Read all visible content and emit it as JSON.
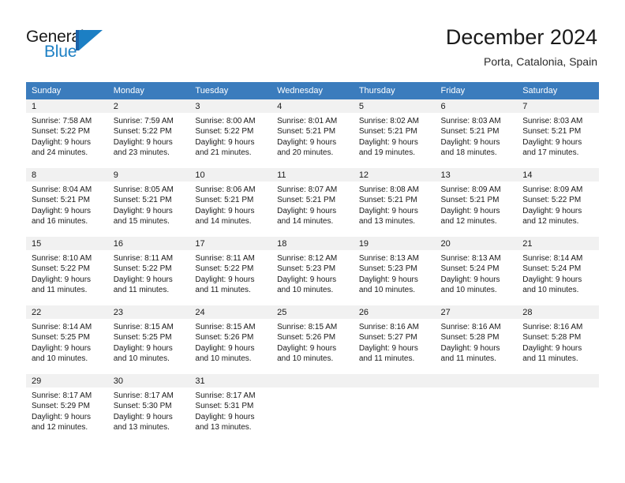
{
  "brand": {
    "name_part1": "General",
    "name_part2": "Blue",
    "mark": "triangle-flag-logo"
  },
  "header": {
    "title": "December 2024",
    "subtitle": "Porta, Catalonia, Spain"
  },
  "calendar": {
    "weekday_headers": [
      "Sunday",
      "Monday",
      "Tuesday",
      "Wednesday",
      "Thursday",
      "Friday",
      "Saturday"
    ],
    "colors": {
      "header_blue": "#3b7cbd",
      "row_divider_blue": "#2e6da4",
      "daynum_band_gray": "#f1f1f1",
      "brand_blue": "#1c7fc4"
    },
    "weeks": [
      {
        "days": [
          {
            "num": "1",
            "sunrise": "Sunrise: 7:58 AM",
            "sunset": "Sunset: 5:22 PM",
            "daylight1": "Daylight: 9 hours",
            "daylight2": "and 24 minutes."
          },
          {
            "num": "2",
            "sunrise": "Sunrise: 7:59 AM",
            "sunset": "Sunset: 5:22 PM",
            "daylight1": "Daylight: 9 hours",
            "daylight2": "and 23 minutes."
          },
          {
            "num": "3",
            "sunrise": "Sunrise: 8:00 AM",
            "sunset": "Sunset: 5:22 PM",
            "daylight1": "Daylight: 9 hours",
            "daylight2": "and 21 minutes."
          },
          {
            "num": "4",
            "sunrise": "Sunrise: 8:01 AM",
            "sunset": "Sunset: 5:21 PM",
            "daylight1": "Daylight: 9 hours",
            "daylight2": "and 20 minutes."
          },
          {
            "num": "5",
            "sunrise": "Sunrise: 8:02 AM",
            "sunset": "Sunset: 5:21 PM",
            "daylight1": "Daylight: 9 hours",
            "daylight2": "and 19 minutes."
          },
          {
            "num": "6",
            "sunrise": "Sunrise: 8:03 AM",
            "sunset": "Sunset: 5:21 PM",
            "daylight1": "Daylight: 9 hours",
            "daylight2": "and 18 minutes."
          },
          {
            "num": "7",
            "sunrise": "Sunrise: 8:03 AM",
            "sunset": "Sunset: 5:21 PM",
            "daylight1": "Daylight: 9 hours",
            "daylight2": "and 17 minutes."
          }
        ]
      },
      {
        "days": [
          {
            "num": "8",
            "sunrise": "Sunrise: 8:04 AM",
            "sunset": "Sunset: 5:21 PM",
            "daylight1": "Daylight: 9 hours",
            "daylight2": "and 16 minutes."
          },
          {
            "num": "9",
            "sunrise": "Sunrise: 8:05 AM",
            "sunset": "Sunset: 5:21 PM",
            "daylight1": "Daylight: 9 hours",
            "daylight2": "and 15 minutes."
          },
          {
            "num": "10",
            "sunrise": "Sunrise: 8:06 AM",
            "sunset": "Sunset: 5:21 PM",
            "daylight1": "Daylight: 9 hours",
            "daylight2": "and 14 minutes."
          },
          {
            "num": "11",
            "sunrise": "Sunrise: 8:07 AM",
            "sunset": "Sunset: 5:21 PM",
            "daylight1": "Daylight: 9 hours",
            "daylight2": "and 14 minutes."
          },
          {
            "num": "12",
            "sunrise": "Sunrise: 8:08 AM",
            "sunset": "Sunset: 5:21 PM",
            "daylight1": "Daylight: 9 hours",
            "daylight2": "and 13 minutes."
          },
          {
            "num": "13",
            "sunrise": "Sunrise: 8:09 AM",
            "sunset": "Sunset: 5:21 PM",
            "daylight1": "Daylight: 9 hours",
            "daylight2": "and 12 minutes."
          },
          {
            "num": "14",
            "sunrise": "Sunrise: 8:09 AM",
            "sunset": "Sunset: 5:22 PM",
            "daylight1": "Daylight: 9 hours",
            "daylight2": "and 12 minutes."
          }
        ]
      },
      {
        "days": [
          {
            "num": "15",
            "sunrise": "Sunrise: 8:10 AM",
            "sunset": "Sunset: 5:22 PM",
            "daylight1": "Daylight: 9 hours",
            "daylight2": "and 11 minutes."
          },
          {
            "num": "16",
            "sunrise": "Sunrise: 8:11 AM",
            "sunset": "Sunset: 5:22 PM",
            "daylight1": "Daylight: 9 hours",
            "daylight2": "and 11 minutes."
          },
          {
            "num": "17",
            "sunrise": "Sunrise: 8:11 AM",
            "sunset": "Sunset: 5:22 PM",
            "daylight1": "Daylight: 9 hours",
            "daylight2": "and 11 minutes."
          },
          {
            "num": "18",
            "sunrise": "Sunrise: 8:12 AM",
            "sunset": "Sunset: 5:23 PM",
            "daylight1": "Daylight: 9 hours",
            "daylight2": "and 10 minutes."
          },
          {
            "num": "19",
            "sunrise": "Sunrise: 8:13 AM",
            "sunset": "Sunset: 5:23 PM",
            "daylight1": "Daylight: 9 hours",
            "daylight2": "and 10 minutes."
          },
          {
            "num": "20",
            "sunrise": "Sunrise: 8:13 AM",
            "sunset": "Sunset: 5:24 PM",
            "daylight1": "Daylight: 9 hours",
            "daylight2": "and 10 minutes."
          },
          {
            "num": "21",
            "sunrise": "Sunrise: 8:14 AM",
            "sunset": "Sunset: 5:24 PM",
            "daylight1": "Daylight: 9 hours",
            "daylight2": "and 10 minutes."
          }
        ]
      },
      {
        "days": [
          {
            "num": "22",
            "sunrise": "Sunrise: 8:14 AM",
            "sunset": "Sunset: 5:25 PM",
            "daylight1": "Daylight: 9 hours",
            "daylight2": "and 10 minutes."
          },
          {
            "num": "23",
            "sunrise": "Sunrise: 8:15 AM",
            "sunset": "Sunset: 5:25 PM",
            "daylight1": "Daylight: 9 hours",
            "daylight2": "and 10 minutes."
          },
          {
            "num": "24",
            "sunrise": "Sunrise: 8:15 AM",
            "sunset": "Sunset: 5:26 PM",
            "daylight1": "Daylight: 9 hours",
            "daylight2": "and 10 minutes."
          },
          {
            "num": "25",
            "sunrise": "Sunrise: 8:15 AM",
            "sunset": "Sunset: 5:26 PM",
            "daylight1": "Daylight: 9 hours",
            "daylight2": "and 10 minutes."
          },
          {
            "num": "26",
            "sunrise": "Sunrise: 8:16 AM",
            "sunset": "Sunset: 5:27 PM",
            "daylight1": "Daylight: 9 hours",
            "daylight2": "and 11 minutes."
          },
          {
            "num": "27",
            "sunrise": "Sunrise: 8:16 AM",
            "sunset": "Sunset: 5:28 PM",
            "daylight1": "Daylight: 9 hours",
            "daylight2": "and 11 minutes."
          },
          {
            "num": "28",
            "sunrise": "Sunrise: 8:16 AM",
            "sunset": "Sunset: 5:28 PM",
            "daylight1": "Daylight: 9 hours",
            "daylight2": "and 11 minutes."
          }
        ]
      },
      {
        "days": [
          {
            "num": "29",
            "sunrise": "Sunrise: 8:17 AM",
            "sunset": "Sunset: 5:29 PM",
            "daylight1": "Daylight: 9 hours",
            "daylight2": "and 12 minutes."
          },
          {
            "num": "30",
            "sunrise": "Sunrise: 8:17 AM",
            "sunset": "Sunset: 5:30 PM",
            "daylight1": "Daylight: 9 hours",
            "daylight2": "and 13 minutes."
          },
          {
            "num": "31",
            "sunrise": "Sunrise: 8:17 AM",
            "sunset": "Sunset: 5:31 PM",
            "daylight1": "Daylight: 9 hours",
            "daylight2": "and 13 minutes."
          },
          {
            "num": "",
            "sunrise": "",
            "sunset": "",
            "daylight1": "",
            "daylight2": ""
          },
          {
            "num": "",
            "sunrise": "",
            "sunset": "",
            "daylight1": "",
            "daylight2": ""
          },
          {
            "num": "",
            "sunrise": "",
            "sunset": "",
            "daylight1": "",
            "daylight2": ""
          },
          {
            "num": "",
            "sunrise": "",
            "sunset": "",
            "daylight1": "",
            "daylight2": ""
          }
        ]
      }
    ]
  }
}
